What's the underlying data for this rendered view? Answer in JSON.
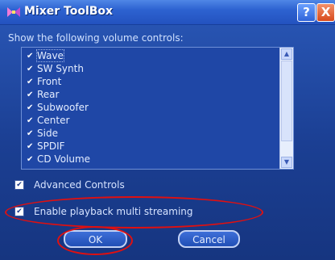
{
  "window": {
    "title": "Mixer ToolBox",
    "help_label": "?",
    "close_label": "X"
  },
  "section_label": "Show the following volume controls:",
  "volume_controls": [
    {
      "label": "Wave",
      "checked": true
    },
    {
      "label": "SW Synth",
      "checked": true
    },
    {
      "label": "Front",
      "checked": true
    },
    {
      "label": "Rear",
      "checked": true
    },
    {
      "label": "Subwoofer",
      "checked": true
    },
    {
      "label": "Center",
      "checked": true
    },
    {
      "label": "Side",
      "checked": true
    },
    {
      "label": "SPDIF",
      "checked": true
    },
    {
      "label": "CD Volume",
      "checked": true
    }
  ],
  "options": {
    "advanced": {
      "label": "Advanced Controls",
      "checked": true
    },
    "streaming": {
      "label": "Enable playback multi streaming",
      "checked": true
    }
  },
  "buttons": {
    "ok": "OK",
    "cancel": "Cancel"
  },
  "colors": {
    "window_bg": "#1e3f8c",
    "annotation": "#e01010"
  },
  "icons": {
    "app": "mixer-app-icon",
    "check": "check-icon"
  }
}
